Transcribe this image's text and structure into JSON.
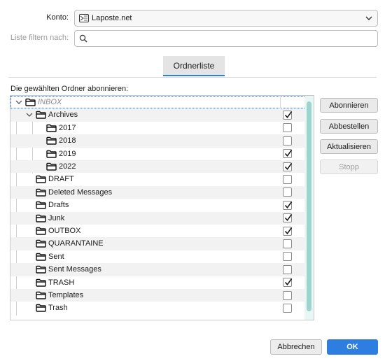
{
  "form": {
    "account_label": "Konto:",
    "account_value": "Laposte.net",
    "filter_label": "Liste filtern nach:",
    "filter_value": ""
  },
  "tabs": [
    {
      "label": "Ordnerliste",
      "selected": true
    }
  ],
  "subscribe_label": "Die gewählten Ordner abonnieren:",
  "folders": [
    {
      "name": "INBOX",
      "level": 0,
      "expanded": true,
      "checked": false,
      "italic": true,
      "focused": true
    },
    {
      "name": "Archives",
      "level": 1,
      "expanded": true,
      "checked": true
    },
    {
      "name": "2017",
      "level": 2,
      "checked": false
    },
    {
      "name": "2018",
      "level": 2,
      "checked": false
    },
    {
      "name": "2019",
      "level": 2,
      "checked": true
    },
    {
      "name": "2022",
      "level": 2,
      "checked": true
    },
    {
      "name": "DRAFT",
      "level": 1,
      "checked": false
    },
    {
      "name": "Deleted Messages",
      "level": 1,
      "checked": false
    },
    {
      "name": "Drafts",
      "level": 1,
      "checked": true
    },
    {
      "name": "Junk",
      "level": 1,
      "checked": true
    },
    {
      "name": "OUTBOX",
      "level": 1,
      "checked": true
    },
    {
      "name": "QUARANTAINE",
      "level": 1,
      "checked": false
    },
    {
      "name": "Sent",
      "level": 1,
      "checked": false
    },
    {
      "name": "Sent Messages",
      "level": 1,
      "checked": false
    },
    {
      "name": "TRASH",
      "level": 1,
      "checked": true
    },
    {
      "name": "Templates",
      "level": 1,
      "checked": false
    },
    {
      "name": "Trash",
      "level": 1,
      "checked": false
    }
  ],
  "side_buttons": {
    "subscribe": "Abonnieren",
    "unsubscribe": "Abbestellen",
    "refresh": "Aktualisieren",
    "stop": "Stopp"
  },
  "footer": {
    "cancel": "Abbrechen",
    "ok": "OK"
  },
  "colors": {
    "accent": "#2d7ee0",
    "scroll_thumb": "#9ed4cf"
  },
  "icons": [
    "account-icon",
    "chevron-down-icon",
    "search-icon",
    "folder-icon",
    "twisty-icon",
    "checkmark-icon"
  ]
}
